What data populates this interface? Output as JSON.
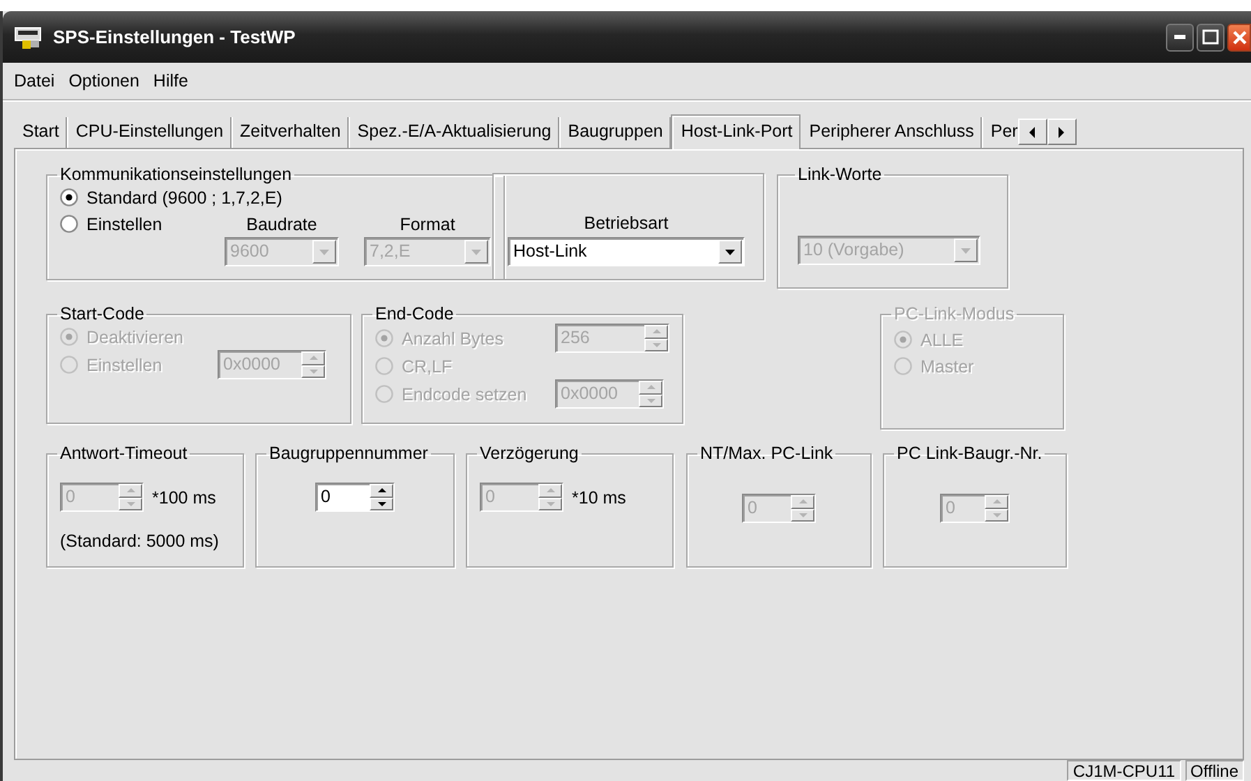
{
  "window": {
    "title": "SPS-Einstellungen - TestWP"
  },
  "menu": [
    {
      "label": "Datei"
    },
    {
      "label": "Optionen"
    },
    {
      "label": "Hilfe"
    }
  ],
  "tabs": [
    {
      "label": "Start",
      "selected": false
    },
    {
      "label": "CPU-Einstellungen",
      "selected": false
    },
    {
      "label": "Zeitverhalten",
      "selected": false
    },
    {
      "label": "Spez.-E/A-Aktualisierung",
      "selected": false
    },
    {
      "label": "Baugruppen",
      "selected": false
    },
    {
      "label": "Host-Link-Port",
      "selected": true
    },
    {
      "label": "Peripherer Anschluss",
      "selected": false
    },
    {
      "label": "Per",
      "selected": false
    }
  ],
  "communication": {
    "title": "Kommunikationseinstellungen",
    "options": [
      {
        "label": "Standard (9600 ; 1,7,2,E)",
        "selected": true,
        "disabled": false
      },
      {
        "label": "Einstellen",
        "selected": false,
        "disabled": false
      }
    ],
    "baudrate": {
      "label": "Baudrate",
      "value": "9600",
      "disabled": true
    },
    "format": {
      "label": "Format",
      "value": "7,2,E",
      "disabled": true
    }
  },
  "operating_mode": {
    "label": "Betriebsart",
    "value": "Host-Link",
    "disabled": false
  },
  "link_words": {
    "title": "Link-Worte",
    "value": "10 (Vorgabe)",
    "disabled": true
  },
  "start_code": {
    "title": "Start-Code",
    "disabled": false,
    "options": [
      {
        "label": "Deaktivieren",
        "selected": true,
        "disabled": true
      },
      {
        "label": "Einstellen",
        "selected": false,
        "disabled": true
      }
    ],
    "code": {
      "value": "0x0000",
      "disabled": true
    }
  },
  "end_code": {
    "title": "End-Code",
    "disabled": false,
    "options": [
      {
        "label": "Anzahl Bytes",
        "selected": true,
        "disabled": true
      },
      {
        "label": "CR,LF",
        "selected": false,
        "disabled": true
      },
      {
        "label": "Endcode setzen",
        "selected": false,
        "disabled": true
      }
    ],
    "bytes": {
      "value": "256",
      "disabled": true
    },
    "code": {
      "value": "0x0000",
      "disabled": true
    }
  },
  "pc_link_mode": {
    "title": "PC-Link-Modus",
    "disabled": true,
    "options": [
      {
        "label": "ALLE",
        "selected": true,
        "disabled": true
      },
      {
        "label": "Master",
        "selected": false,
        "disabled": true
      }
    ]
  },
  "settings": [
    {
      "title": "Antwort-Timeout",
      "value": "0",
      "unit": "*100 ms",
      "note": "(Standard: 5000 ms)",
      "disabled": true
    },
    {
      "title": "Baugruppennummer",
      "value": "0",
      "disabled": false
    },
    {
      "title": "Verzögerung",
      "value": "0",
      "unit": "*10 ms",
      "disabled": true
    },
    {
      "title": "NT/Max. PC-Link",
      "value": "0",
      "disabled": true
    },
    {
      "title": "PC Link-Baugr.-Nr.",
      "value": "0",
      "disabled": true
    }
  ],
  "status_bar": [
    {
      "text": "CJ1M-CPU11"
    },
    {
      "text": "Offline"
    }
  ]
}
